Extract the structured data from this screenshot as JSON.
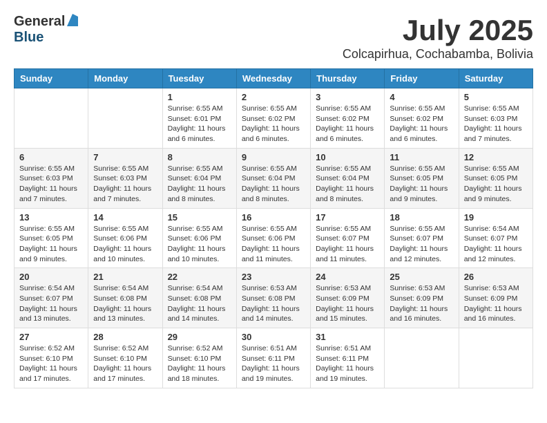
{
  "logo": {
    "general": "General",
    "blue": "Blue"
  },
  "title": {
    "month": "July 2025",
    "location": "Colcapirhua, Cochabamba, Bolivia"
  },
  "calendar": {
    "headers": [
      "Sunday",
      "Monday",
      "Tuesday",
      "Wednesday",
      "Thursday",
      "Friday",
      "Saturday"
    ],
    "weeks": [
      [
        {
          "day": "",
          "info": ""
        },
        {
          "day": "",
          "info": ""
        },
        {
          "day": "1",
          "info": "Sunrise: 6:55 AM\nSunset: 6:01 PM\nDaylight: 11 hours and 6 minutes."
        },
        {
          "day": "2",
          "info": "Sunrise: 6:55 AM\nSunset: 6:02 PM\nDaylight: 11 hours and 6 minutes."
        },
        {
          "day": "3",
          "info": "Sunrise: 6:55 AM\nSunset: 6:02 PM\nDaylight: 11 hours and 6 minutes."
        },
        {
          "day": "4",
          "info": "Sunrise: 6:55 AM\nSunset: 6:02 PM\nDaylight: 11 hours and 6 minutes."
        },
        {
          "day": "5",
          "info": "Sunrise: 6:55 AM\nSunset: 6:03 PM\nDaylight: 11 hours and 7 minutes."
        }
      ],
      [
        {
          "day": "6",
          "info": "Sunrise: 6:55 AM\nSunset: 6:03 PM\nDaylight: 11 hours and 7 minutes."
        },
        {
          "day": "7",
          "info": "Sunrise: 6:55 AM\nSunset: 6:03 PM\nDaylight: 11 hours and 7 minutes."
        },
        {
          "day": "8",
          "info": "Sunrise: 6:55 AM\nSunset: 6:04 PM\nDaylight: 11 hours and 8 minutes."
        },
        {
          "day": "9",
          "info": "Sunrise: 6:55 AM\nSunset: 6:04 PM\nDaylight: 11 hours and 8 minutes."
        },
        {
          "day": "10",
          "info": "Sunrise: 6:55 AM\nSunset: 6:04 PM\nDaylight: 11 hours and 8 minutes."
        },
        {
          "day": "11",
          "info": "Sunrise: 6:55 AM\nSunset: 6:05 PM\nDaylight: 11 hours and 9 minutes."
        },
        {
          "day": "12",
          "info": "Sunrise: 6:55 AM\nSunset: 6:05 PM\nDaylight: 11 hours and 9 minutes."
        }
      ],
      [
        {
          "day": "13",
          "info": "Sunrise: 6:55 AM\nSunset: 6:05 PM\nDaylight: 11 hours and 9 minutes."
        },
        {
          "day": "14",
          "info": "Sunrise: 6:55 AM\nSunset: 6:06 PM\nDaylight: 11 hours and 10 minutes."
        },
        {
          "day": "15",
          "info": "Sunrise: 6:55 AM\nSunset: 6:06 PM\nDaylight: 11 hours and 10 minutes."
        },
        {
          "day": "16",
          "info": "Sunrise: 6:55 AM\nSunset: 6:06 PM\nDaylight: 11 hours and 11 minutes."
        },
        {
          "day": "17",
          "info": "Sunrise: 6:55 AM\nSunset: 6:07 PM\nDaylight: 11 hours and 11 minutes."
        },
        {
          "day": "18",
          "info": "Sunrise: 6:55 AM\nSunset: 6:07 PM\nDaylight: 11 hours and 12 minutes."
        },
        {
          "day": "19",
          "info": "Sunrise: 6:54 AM\nSunset: 6:07 PM\nDaylight: 11 hours and 12 minutes."
        }
      ],
      [
        {
          "day": "20",
          "info": "Sunrise: 6:54 AM\nSunset: 6:07 PM\nDaylight: 11 hours and 13 minutes."
        },
        {
          "day": "21",
          "info": "Sunrise: 6:54 AM\nSunset: 6:08 PM\nDaylight: 11 hours and 13 minutes."
        },
        {
          "day": "22",
          "info": "Sunrise: 6:54 AM\nSunset: 6:08 PM\nDaylight: 11 hours and 14 minutes."
        },
        {
          "day": "23",
          "info": "Sunrise: 6:53 AM\nSunset: 6:08 PM\nDaylight: 11 hours and 14 minutes."
        },
        {
          "day": "24",
          "info": "Sunrise: 6:53 AM\nSunset: 6:09 PM\nDaylight: 11 hours and 15 minutes."
        },
        {
          "day": "25",
          "info": "Sunrise: 6:53 AM\nSunset: 6:09 PM\nDaylight: 11 hours and 16 minutes."
        },
        {
          "day": "26",
          "info": "Sunrise: 6:53 AM\nSunset: 6:09 PM\nDaylight: 11 hours and 16 minutes."
        }
      ],
      [
        {
          "day": "27",
          "info": "Sunrise: 6:52 AM\nSunset: 6:10 PM\nDaylight: 11 hours and 17 minutes."
        },
        {
          "day": "28",
          "info": "Sunrise: 6:52 AM\nSunset: 6:10 PM\nDaylight: 11 hours and 17 minutes."
        },
        {
          "day": "29",
          "info": "Sunrise: 6:52 AM\nSunset: 6:10 PM\nDaylight: 11 hours and 18 minutes."
        },
        {
          "day": "30",
          "info": "Sunrise: 6:51 AM\nSunset: 6:11 PM\nDaylight: 11 hours and 19 minutes."
        },
        {
          "day": "31",
          "info": "Sunrise: 6:51 AM\nSunset: 6:11 PM\nDaylight: 11 hours and 19 minutes."
        },
        {
          "day": "",
          "info": ""
        },
        {
          "day": "",
          "info": ""
        }
      ]
    ]
  }
}
